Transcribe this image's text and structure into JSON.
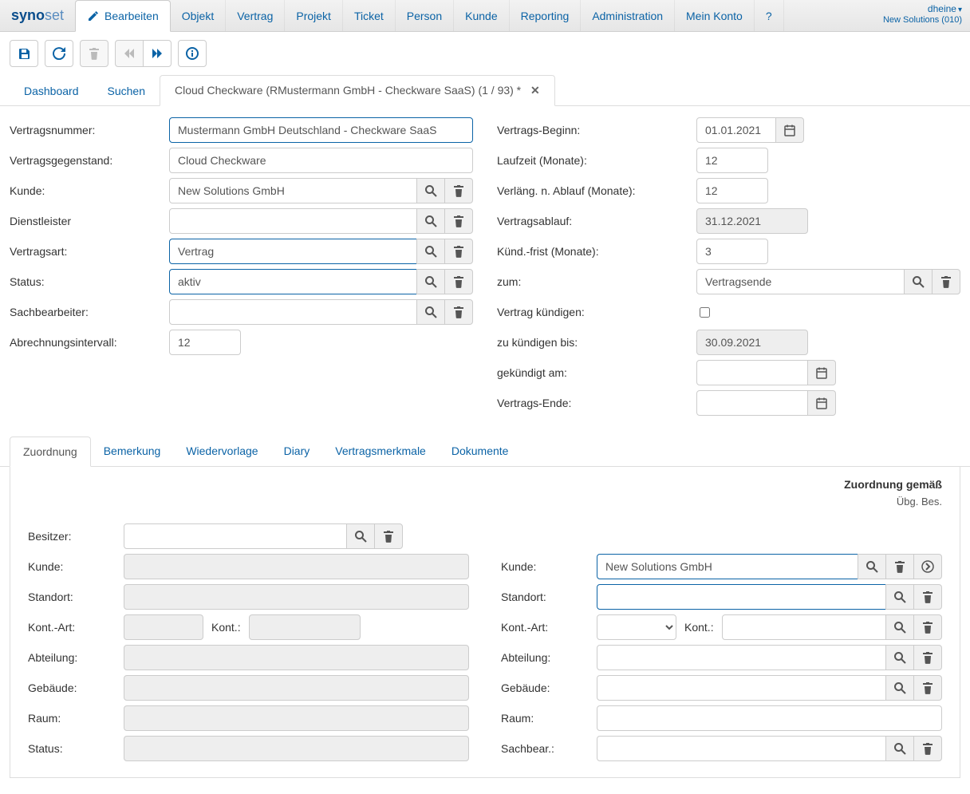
{
  "brand": {
    "part1": "syno",
    "part2": "set"
  },
  "user": {
    "name": "dheine",
    "org": "New Solutions (010)"
  },
  "topnav": {
    "bearbeiten": "Bearbeiten",
    "objekt": "Objekt",
    "vertrag": "Vertrag",
    "projekt": "Projekt",
    "ticket": "Ticket",
    "person": "Person",
    "kunde": "Kunde",
    "reporting": "Reporting",
    "administration": "Administration",
    "mein_konto": "Mein Konto",
    "help": "?"
  },
  "pagetabs": {
    "dashboard": "Dashboard",
    "suchen": "Suchen",
    "current": "Cloud Checkware (RMustermann GmbH - Checkware SaaS) (1 / 93) *"
  },
  "labels": {
    "vertragsnummer": "Vertragsnummer:",
    "vertragsgegenstand": "Vertragsgegenstand:",
    "kunde": "Kunde:",
    "dienstleister": "Dienstleister",
    "vertragsart": "Vertragsart:",
    "status": "Status:",
    "sachbearbeiter": "Sachbearbeiter:",
    "abrechnungsintervall": "Abrechnungsintervall:",
    "vertrags_beginn": "Vertrags-Beginn:",
    "laufzeit": "Laufzeit (Monate):",
    "verlaeng": "Verläng. n. Ablauf (Monate):",
    "vertragsablauf": "Vertragsablauf:",
    "kuendfrist": "Künd.-frist (Monate):",
    "zum": "zum:",
    "vertrag_kuendigen": "Vertrag kündigen:",
    "zu_kuendigen_bis": "zu kündigen bis:",
    "gekuendigt_am": "gekündigt am:",
    "vertrags_ende": "Vertrags-Ende:"
  },
  "values": {
    "vertragsnummer": "Mustermann GmbH Deutschland - Checkware SaaS",
    "vertragsgegenstand": "Cloud Checkware",
    "kunde": "New Solutions GmbH",
    "dienstleister": "",
    "vertragsart": "Vertrag",
    "status": "aktiv",
    "sachbearbeiter": "",
    "abrechnungsintervall": "12",
    "vertrags_beginn": "01.01.2021",
    "laufzeit": "12",
    "verlaeng": "12",
    "vertragsablauf": "31.12.2021",
    "kuendfrist": "3",
    "zum": "Vertragsende",
    "zu_kuendigen_bis": "30.09.2021",
    "gekuendigt_am": "",
    "vertrags_ende": ""
  },
  "subtabs": {
    "zuordnung": "Zuordnung",
    "bemerkung": "Bemerkung",
    "wiedervorlage": "Wiedervorlage",
    "diary": "Diary",
    "vertragsmerkmale": "Vertragsmerkmale",
    "dokumente": "Dokumente"
  },
  "zuordnung": {
    "heading": "Zuordnung gemäß",
    "subheading": "Übg. Bes.",
    "left": {
      "besitzer": "Besitzer:",
      "kunde": "Kunde:",
      "standort": "Standort:",
      "kontart": "Kont.-Art:",
      "kont": "Kont.:",
      "abteilung": "Abteilung:",
      "gebaeude": "Gebäude:",
      "raum": "Raum:",
      "status": "Status:"
    },
    "right": {
      "kunde": "Kunde:",
      "kunde_val": "New Solutions GmbH",
      "standort": "Standort:",
      "kontart": "Kont.-Art:",
      "kont": "Kont.:",
      "abteilung": "Abteilung:",
      "gebaeude": "Gebäude:",
      "raum": "Raum:",
      "sachbear": "Sachbear.:"
    }
  }
}
